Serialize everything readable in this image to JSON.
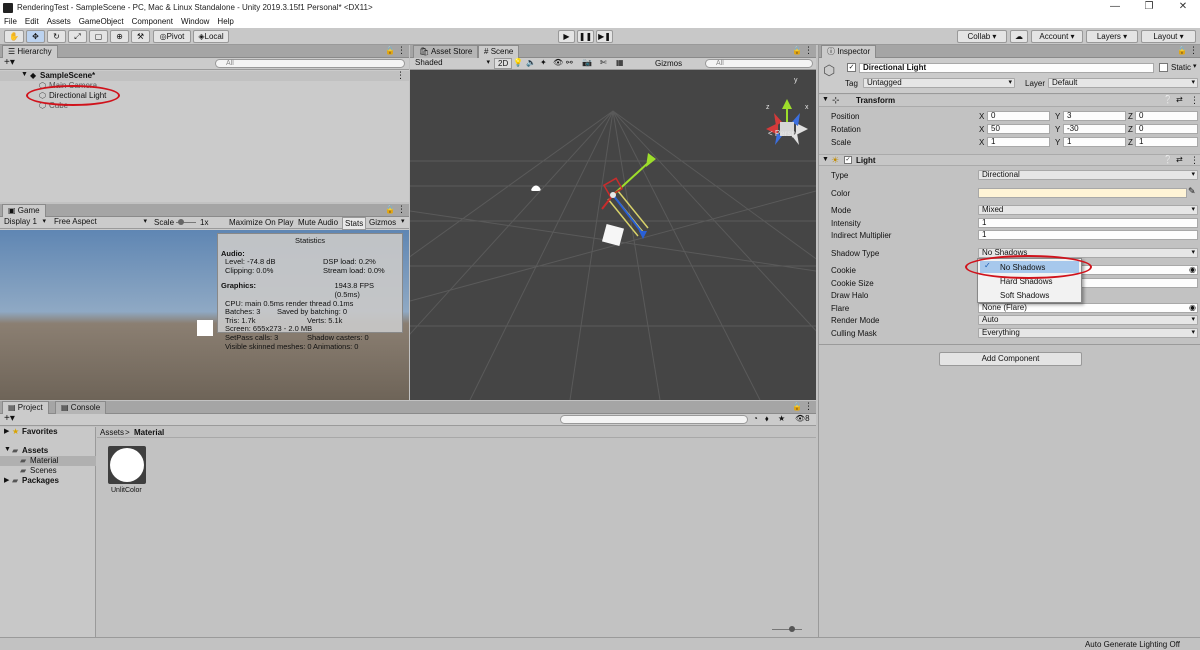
{
  "window": {
    "title": "RenderingTest - SampleScene - PC, Mac & Linux Standalone - Unity 2019.3.15f1 Personal* <DX11>",
    "controls": [
      "—",
      "❐",
      "✕"
    ]
  },
  "menu": [
    "File",
    "Edit",
    "Assets",
    "GameObject",
    "Component",
    "Window",
    "Help"
  ],
  "toolbar": {
    "pivot": "Pivot",
    "local": "Local",
    "collab": "Collab ▾",
    "account": "Account",
    "layers": "Layers",
    "layout": "Layout"
  },
  "hierarchy": {
    "tab": "Hierarchy",
    "search_placeholder": "All",
    "scene": "SampleScene*",
    "items": [
      "Main Camera",
      "Directional Light",
      "Cube"
    ]
  },
  "scene": {
    "tabs": [
      "Asset Store",
      "Scene"
    ],
    "shading": "Shaded",
    "mode2d": "2D",
    "gizmos": "Gizmos",
    "search_placeholder": "All",
    "persp": "< Persp"
  },
  "game": {
    "tab": "Game",
    "display": "Display 1",
    "aspect": "Free Aspect",
    "scale_label": "Scale",
    "scale_value": "1x",
    "buttons": [
      "Maximize On Play",
      "Mute Audio",
      "Stats",
      "Gizmos"
    ]
  },
  "stats": {
    "title": "Statistics",
    "audio_header": "Audio:",
    "audio": [
      [
        "Level: -74.8 dB",
        "DSP load: 0.2%"
      ],
      [
        "Clipping: 0.0%",
        "Stream load: 0.0%"
      ]
    ],
    "graphics_header": "Graphics:",
    "fps": "1943.8 FPS (0.5ms)",
    "cpu": "CPU: main 0.5ms  render thread 0.1ms",
    "rows": [
      [
        "Batches: 3",
        "Saved by batching: 0"
      ],
      [
        "Tris: 1.7k",
        "Verts: 5.1k"
      ],
      [
        "Screen: 655x273 - 2.0 MB",
        ""
      ],
      [
        "SetPass calls: 3",
        "Shadow casters: 0"
      ],
      [
        "Visible skinned meshes: 0",
        "Animations: 0"
      ]
    ]
  },
  "project": {
    "tabs": [
      "Project",
      "Console"
    ],
    "favorites": "Favorites",
    "assets": "Assets",
    "folders": [
      "Material",
      "Scenes"
    ],
    "packages": "Packages",
    "breadcrumb": [
      "Assets",
      "Material"
    ],
    "asset_name": "UnlitColor",
    "count": "8"
  },
  "inspector": {
    "tab": "Inspector",
    "object_name": "Directional Light",
    "static_label": "Static",
    "tag_label": "Tag",
    "tag_value": "Untagged",
    "layer_label": "Layer",
    "layer_value": "Default",
    "transform": {
      "header": "Transform",
      "rows": [
        {
          "label": "Position",
          "x": "0",
          "y": "3",
          "z": "0"
        },
        {
          "label": "Rotation",
          "x": "50",
          "y": "-30",
          "z": "0"
        },
        {
          "label": "Scale",
          "x": "1",
          "y": "1",
          "z": "1"
        }
      ]
    },
    "light": {
      "header": "Light",
      "type_label": "Type",
      "type_value": "Directional",
      "color_label": "Color",
      "color_value": "#fff4d6",
      "mode_label": "Mode",
      "mode_value": "Mixed",
      "intensity_label": "Intensity",
      "intensity_value": "1",
      "indirect_label": "Indirect Multiplier",
      "indirect_value": "1",
      "shadow_label": "Shadow Type",
      "shadow_value": "No Shadows",
      "cookie_label": "Cookie",
      "cookie_size_label": "Cookie Size",
      "draw_halo_label": "Draw Halo",
      "flare_label": "Flare",
      "flare_value": "None (Flare)",
      "render_mode_label": "Render Mode",
      "render_mode_value": "Auto",
      "culling_label": "Culling Mask",
      "culling_value": "Everything"
    },
    "add_component": "Add Component",
    "shadow_options": [
      "No Shadows",
      "Hard Shadows",
      "Soft Shadows"
    ],
    "shadow_selected": 0
  },
  "status": {
    "text": "Auto Generate Lighting Off"
  },
  "colors": {
    "highlight": "#d0121b",
    "selection": "#3d8ee4",
    "scene_bg": "#444444"
  }
}
